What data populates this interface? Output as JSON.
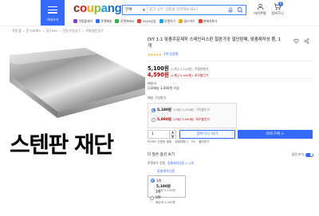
{
  "header": {
    "menu_label": "카테고리",
    "logo_letters": [
      {
        "ch": "c",
        "color": "#7a2d12"
      },
      {
        "ch": "o",
        "color": "#d0201c"
      },
      {
        "ch": "u",
        "color": "#f2a71c"
      },
      {
        "ch": "p",
        "color": "#8dbb33"
      },
      {
        "ch": "a",
        "color": "#1ea0e0"
      },
      {
        "ch": "n",
        "color": "#1b6ad6"
      },
      {
        "ch": "g",
        "color": "#1b6ad6"
      }
    ],
    "search": {
      "category": "전체",
      "placeholder": "찾고 싶은 상품을 검색해보세요!"
    },
    "mycoupang_label": "마이쿠팡",
    "cart_label": "장바구니",
    "cart_count": "0",
    "quicklinks": [
      {
        "label": "쿠팡플레이",
        "color": "#7d3fd6"
      },
      {
        "label": "로켓배송",
        "color": "#346aff"
      },
      {
        "label": "로켓프레시",
        "color": "#2ab33f"
      },
      {
        "label": "2024신상",
        "color": "#e4462f"
      },
      {
        "label": "로켓직구",
        "color": "#1fa3df"
      },
      {
        "label": "골드박스",
        "color": "#f2a71c"
      },
      {
        "label": "판매자특가",
        "color": "#e4462f"
      }
    ]
  },
  "breadcrumb": [
    "쿠팡 홈",
    "문구/오피스",
    "공구/DIY",
    "전동/수동공구",
    "가위/절단공구"
  ],
  "product": {
    "image_caption": "스텐판 재단",
    "title": "DIY 1:1 맞춤주문제작 스테인리스판 철판가공 절단판매, 맞춤재작성 품, 1개",
    "rating_stars": "★★★★★",
    "rating_count": "3개 상품평",
    "price": "5,100원",
    "price_unit": "(1개당 5,100원)",
    "price_tag": "쿠팡판매가",
    "sale_price": "4,590원",
    "sale_unit": "(1개당 4,590원)",
    "sale_tag": "와우할인가",
    "shipping_label": "배송비",
    "shipping_value": "무료배송 3,000원 이상",
    "option_label": "배송 구성방식",
    "option_rows": [
      {
        "price": "5,100원",
        "unit": "(1개당 5,100원)",
        "tag": "구독할인가"
      },
      {
        "price": "5,990원",
        "unit": "(1개당 5,990원)",
        "tag": "와우할인가"
      }
    ],
    "quantity": "1",
    "cart_button": "장바구니 담기",
    "buy_button": "바로구매 >",
    "benefits": [
      "PC카드 간편한 결제",
      "쿠페이머니",
      "5%",
      "할인받기"
    ],
    "more_options_label": "더 많은 옵션 보기",
    "more_options_toggle_label": "옵션 보기",
    "seller_row": [
      "로켓와우 전용",
      "맞춤제작상품 > 1개"
    ],
    "option2_header": "맞춤제작상품",
    "option2": {
      "name": "1개",
      "price": "5,100원",
      "unit": "1개당 5,100원"
    },
    "option3": {
      "name": "1개",
      "price": "0원",
      "unit": "배송비 3,000원"
    }
  }
}
